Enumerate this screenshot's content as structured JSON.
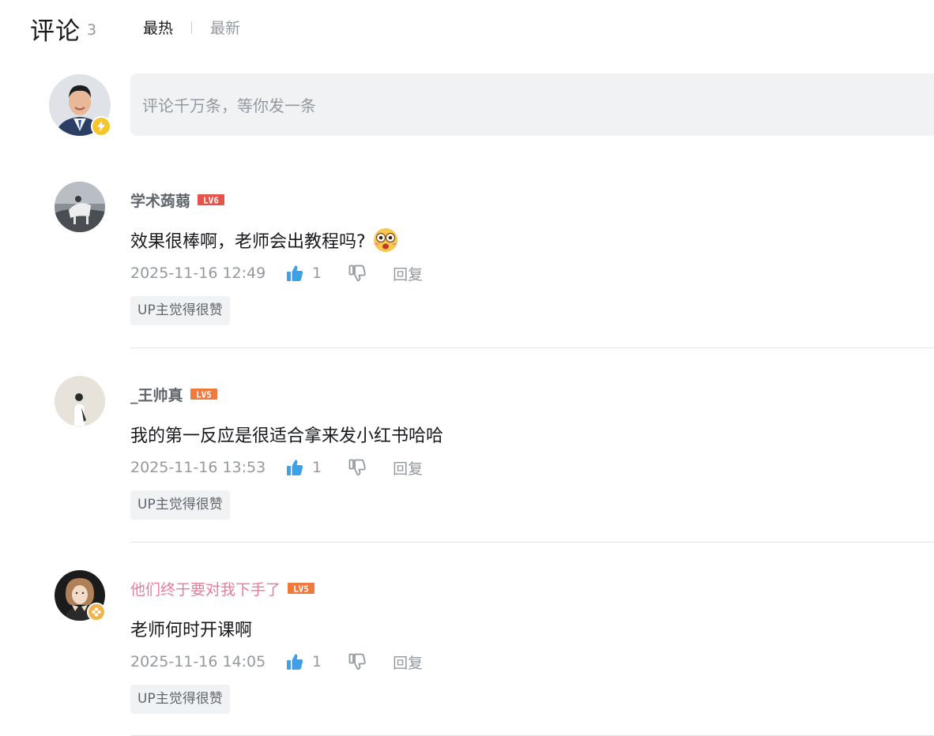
{
  "header": {
    "title": "评论",
    "count": "3",
    "sort_hot": "最热",
    "sort_new": "最新"
  },
  "composer": {
    "placeholder": "评论千万条，等你发一条",
    "badge_icon": "lightning-icon"
  },
  "comments": [
    {
      "username": "学术蒟蒻",
      "level": "LV6",
      "level_color": "#e4544a",
      "text": "效果很棒啊，老师会出教程吗?",
      "emoji": "surprised-face-icon",
      "time": "2025-11-16 12:49",
      "likes": "1",
      "liked": true,
      "reply_label": "回复",
      "tag": "UP主觉得很赞"
    },
    {
      "username": "_王帅真",
      "level": "LV5",
      "level_color": "#f07a3b",
      "text": "我的第一反应是很适合拿来发小红书哈哈",
      "time": "2025-11-16 13:53",
      "likes": "1",
      "liked": true,
      "reply_label": "回复",
      "tag": "UP主觉得很赞"
    },
    {
      "username": "他们终于要对我下手了",
      "level": "LV5",
      "level_color": "#f07a3b",
      "username_color": "#e87c9d",
      "text": "老师何时开课啊",
      "time": "2025-11-16 14:05",
      "likes": "1",
      "liked": true,
      "reply_label": "回复",
      "tag": "UP主觉得很赞"
    }
  ],
  "colors": {
    "accent_like": "#3ea0e6",
    "muted": "#9499a0",
    "vip_name": "#e87c9d"
  }
}
